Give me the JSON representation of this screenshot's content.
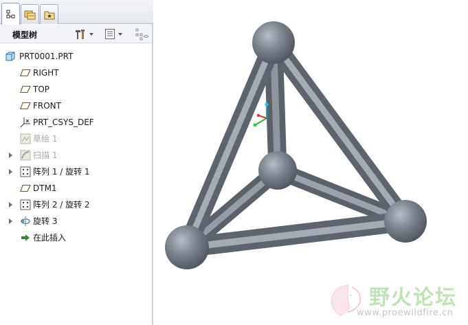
{
  "tabs": [
    {
      "name": "model-tree-tab",
      "icon": "model-tree-icon",
      "active": true
    },
    {
      "name": "folder-browser-tab",
      "icon": "folder-browser-icon",
      "active": false
    },
    {
      "name": "favorites-tab",
      "icon": "favorites-icon",
      "active": false
    }
  ],
  "toolbar": {
    "title": "模型树",
    "settings_icon": "tools-icon",
    "show_icon": "list-icon",
    "filter_icon": "filter-icon"
  },
  "tree": {
    "root": {
      "label": "PRT0001.PRT",
      "icon": "part-icon"
    },
    "items": [
      {
        "label": "RIGHT",
        "icon": "datum-plane-icon",
        "expandable": false,
        "dim": false
      },
      {
        "label": "TOP",
        "icon": "datum-plane-icon",
        "expandable": false,
        "dim": false
      },
      {
        "label": "FRONT",
        "icon": "datum-plane-icon",
        "expandable": false,
        "dim": false
      },
      {
        "label": "PRT_CSYS_DEF",
        "icon": "csys-icon",
        "expandable": false,
        "dim": false
      },
      {
        "label": "草绘 1",
        "icon": "sketch-icon",
        "expandable": false,
        "dim": true
      },
      {
        "label": "扫描 1",
        "icon": "sweep-icon",
        "expandable": true,
        "dim": true
      },
      {
        "label": "阵列 1 / 旋转 1",
        "icon": "pattern-icon",
        "expandable": true,
        "dim": false
      },
      {
        "label": "DTM1",
        "icon": "datum-plane-icon",
        "expandable": false,
        "dim": false
      },
      {
        "label": "阵列 2 / 旋转 2",
        "icon": "pattern-icon",
        "expandable": true,
        "dim": false
      },
      {
        "label": "旋转 3",
        "icon": "revolve-icon",
        "expandable": true,
        "dim": false
      },
      {
        "label": "在此插入",
        "icon": "insert-here-arrow-icon",
        "expandable": false,
        "dim": false
      }
    ]
  },
  "model": {
    "name": "tetrahedron-frame",
    "color": "#7d858f"
  },
  "watermark": {
    "title": "野火论坛",
    "url": "www.proewildfire.cn"
  }
}
